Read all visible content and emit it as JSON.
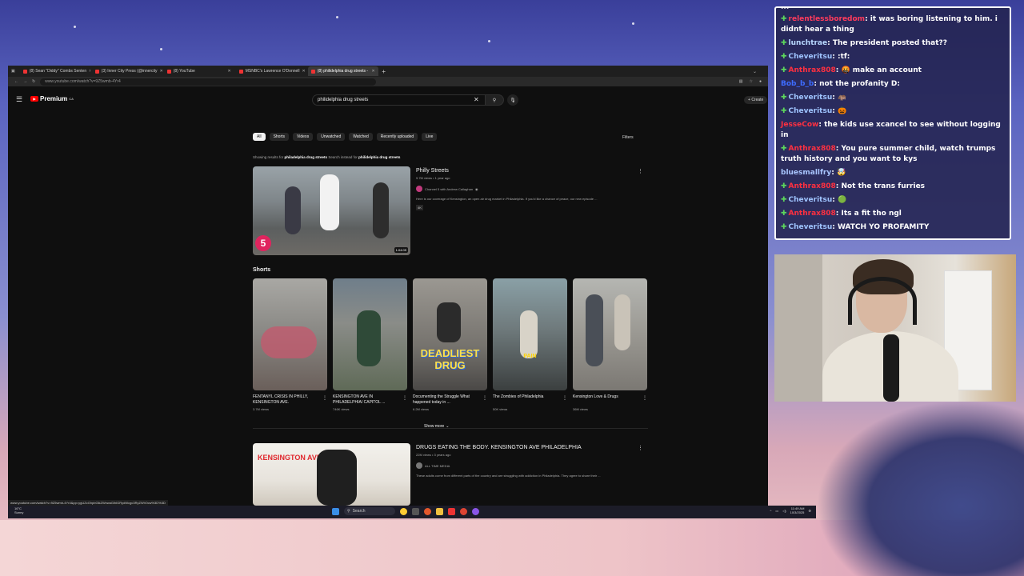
{
  "browser": {
    "tabs": [
      {
        "label": "(8) Sean \"Diddy\" Combs Senten",
        "active": false
      },
      {
        "label": "(3) Inner City Press (@innercity",
        "active": false
      },
      {
        "label": "(8) YouTube",
        "active": false
      },
      {
        "label": "MSNBC's Lawrence O'Donnell",
        "active": false
      },
      {
        "label": "(8) philidelphia drug streets -",
        "active": true
      }
    ],
    "url": "www.youtube.com/watch?v=9Z5wmb-4Yr4",
    "status_url": "www.youtube.com/watch?v=9Z5wmb-4Yr4&pp=ygUZcGhpbGlkZWxwaGlhIGRydWcgc3RyZWV0cw%3D%3D"
  },
  "youtube": {
    "logo_text": "Premium",
    "logo_sup": "CA",
    "search_query": "philidelphia drug streets",
    "create_label": "Create",
    "chips": [
      {
        "label": "All",
        "active": true
      },
      {
        "label": "Shorts",
        "active": false
      },
      {
        "label": "Videos",
        "active": false
      },
      {
        "label": "Unwatched",
        "active": false
      },
      {
        "label": "Watched",
        "active": false
      },
      {
        "label": "Recently uploaded",
        "active": false
      },
      {
        "label": "Live",
        "active": false
      }
    ],
    "filters_label": "Filters",
    "showing_prefix": "Showing results for",
    "showing_query": "philadelphia drug streets",
    "search_instead_prefix": "Search instead for",
    "search_instead_query": "philidelphia drug streets",
    "result1": {
      "title": "Philly Streets",
      "meta": "9.7M views • 1 year ago",
      "channel": "Channel 5 with Andrew Callaghan",
      "description": "Here is our coverage of Kensington, an open air drug market in Philadelphia. If you'd like a chance of peace, our new episode ...",
      "badge": "4K",
      "duration": "1:04:09"
    },
    "shorts_label": "Shorts",
    "shorts": [
      {
        "title": "FENTANYL CRISIS IN PHILLY, KENSINGTON AVE.",
        "views": "3.7M views",
        "overlay": ""
      },
      {
        "title": "KENSINGTON AVE IN PHILADELPHIA/ CAPITOL ...",
        "views": "746K views",
        "overlay": ""
      },
      {
        "title": "Documenting the Struggle What happened today in ...",
        "views": "6.2M views",
        "overlay": "DEADLIEST DRUG"
      },
      {
        "title": "The Zombies of Philadelphia",
        "views": "50K views",
        "overlay": "PAIN"
      },
      {
        "title": "Kensington Love & Drugs",
        "views": "36M views",
        "overlay": ""
      }
    ],
    "show_more": "Show more",
    "result2": {
      "title": "DRUGS EATING THE BODY. KENSINGTON AVE PHILADELPHIA",
      "meta": "22M views • 3 years ago",
      "channel": "ALL TIME MEDIA",
      "description": "These adults come from different parts of the country and are struggling with addiction in Philadelphia. They agree to share their ...",
      "thumb_text": "KENSINGTON AVE"
    }
  },
  "taskbar": {
    "weather_temp": "16°C",
    "weather_desc": "Sunny",
    "search_label": "Search",
    "time": "11:49 AM",
    "date": "10/3/2025"
  },
  "chat": {
    "top_cut": "...",
    "messages": [
      {
        "user": "relentlessboredom",
        "text": "it was boring listening to him. i didnt hear a thing",
        "color": "#ff3b5c",
        "badge": true
      },
      {
        "user": "lunchtrae",
        "text": "The president posted that??",
        "color": "#b8d8ff",
        "badge": true
      },
      {
        "user": "Cheveritsu",
        "text": ":tf:",
        "color": "#9fc4ff",
        "badge": true
      },
      {
        "user": "Anthrax808",
        "text": "🤬 make an account",
        "color": "#ff3040",
        "badge": true
      },
      {
        "user": "Bob_b_b",
        "text": "not the profanity D:",
        "color": "#3e6cff",
        "badge": false
      },
      {
        "user": "Cheveritsu",
        "text": "🦛",
        "color": "#9fc4ff",
        "badge": true
      },
      {
        "user": "Cheveritsu",
        "text": "🎃",
        "color": "#9fc4ff",
        "badge": true
      },
      {
        "user": "JesseCow",
        "text": "the kids use xcancel to see without logging in",
        "color": "#ff3040",
        "badge": false
      },
      {
        "user": "Anthrax808",
        "text": "You pure summer child, watch trumps truth history and you want to kys",
        "color": "#ff3040",
        "badge": true
      },
      {
        "user": "bluesmallfry",
        "text": "🤯",
        "color": "#a9c6ff",
        "badge": false
      },
      {
        "user": "Anthrax808",
        "text": "Not the trans furries",
        "color": "#ff3040",
        "badge": true
      },
      {
        "user": "Cheveritsu",
        "text": "🟢",
        "color": "#9fc4ff",
        "badge": true
      },
      {
        "user": "Anthrax808",
        "text": "Its a fit tho ngl",
        "color": "#ff3040",
        "badge": true
      },
      {
        "user": "Cheveritsu",
        "text": "WATCH YO PROFAMITY",
        "color": "#9fc4ff",
        "badge": true
      }
    ]
  },
  "colors": {
    "yt_bg": "#0f0f0f",
    "yt_red": "#ff0000",
    "chat_border": "#ffffff"
  }
}
